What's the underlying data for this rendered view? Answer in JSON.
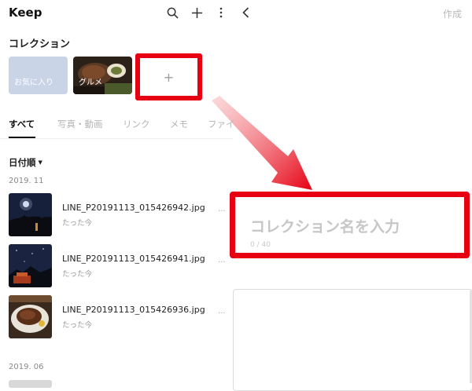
{
  "app": {
    "title": "Keep"
  },
  "toolbar": {
    "create_label": "作成"
  },
  "collections": {
    "title": "コレクション",
    "items": [
      {
        "label": "お気に入り"
      },
      {
        "label": "グルメ"
      }
    ],
    "add_label": "+"
  },
  "tabs": [
    {
      "label": "すべて",
      "active": true
    },
    {
      "label": "写真・動画"
    },
    {
      "label": "リンク"
    },
    {
      "label": "メモ"
    },
    {
      "label": "ファイ"
    }
  ],
  "sort": {
    "label": "日付順"
  },
  "groups": [
    {
      "date": "2019. 11"
    },
    {
      "date": "2019. 06"
    }
  ],
  "files": [
    {
      "name": "LINE_P20191113_015426942.jpg",
      "time": "たった今",
      "more": "···"
    },
    {
      "name": "LINE_P20191113_015426941.jpg",
      "time": "たった今",
      "more": "···"
    },
    {
      "name": "LINE_P20191113_015426936.jpg",
      "time": "たった今",
      "more": "···"
    }
  ],
  "new_collection": {
    "placeholder": "コレクション名を入力",
    "counter": "0 / 40"
  },
  "colors": {
    "highlight": "#e60012",
    "favorites_card": "#c9d4e6"
  },
  "icons": [
    "search-icon",
    "plus-icon",
    "more-vertical-icon",
    "back-chevron-icon"
  ]
}
